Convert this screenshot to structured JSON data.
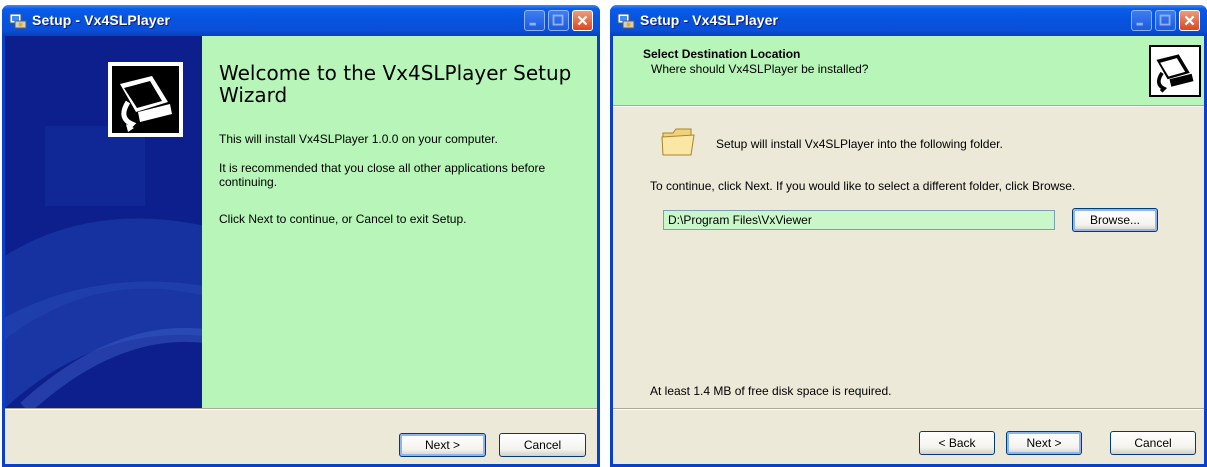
{
  "window1": {
    "title": "Setup - Vx4SLPlayer",
    "welcome_title": "Welcome to the Vx4SLPlayer Setup Wizard",
    "para1": "This will install Vx4SLPlayer 1.0.0 on your computer.",
    "para2": "It is recommended that you close all other applications before continuing.",
    "para3": "Click Next to continue, or Cancel to exit Setup.",
    "next_label": "Next >",
    "cancel_label": "Cancel"
  },
  "window2": {
    "title": "Setup - Vx4SLPlayer",
    "header_title": "Select Destination Location",
    "header_subtitle": "Where should Vx4SLPlayer be installed?",
    "folder_text": "Setup will install Vx4SLPlayer into the following folder.",
    "continue_text": "To continue, click Next. If you would like to select a different folder, click Browse.",
    "path_value": "D:\\Program Files\\VxViewer",
    "browse_label": "Browse...",
    "space_text": "At least 1.4 MB of free disk space is required.",
    "back_label": "< Back",
    "next_label": "Next >",
    "cancel_label": "Cancel"
  },
  "icons": {
    "title_icon": "setup-icon",
    "wizard_image": "computer-install-icon",
    "folder": "folder-icon"
  },
  "colors": {
    "titlebar": "#0654df",
    "content_green": "#b8f5b8",
    "side_panel": "#0c1f8d",
    "dialog_face": "#ece9d8"
  }
}
